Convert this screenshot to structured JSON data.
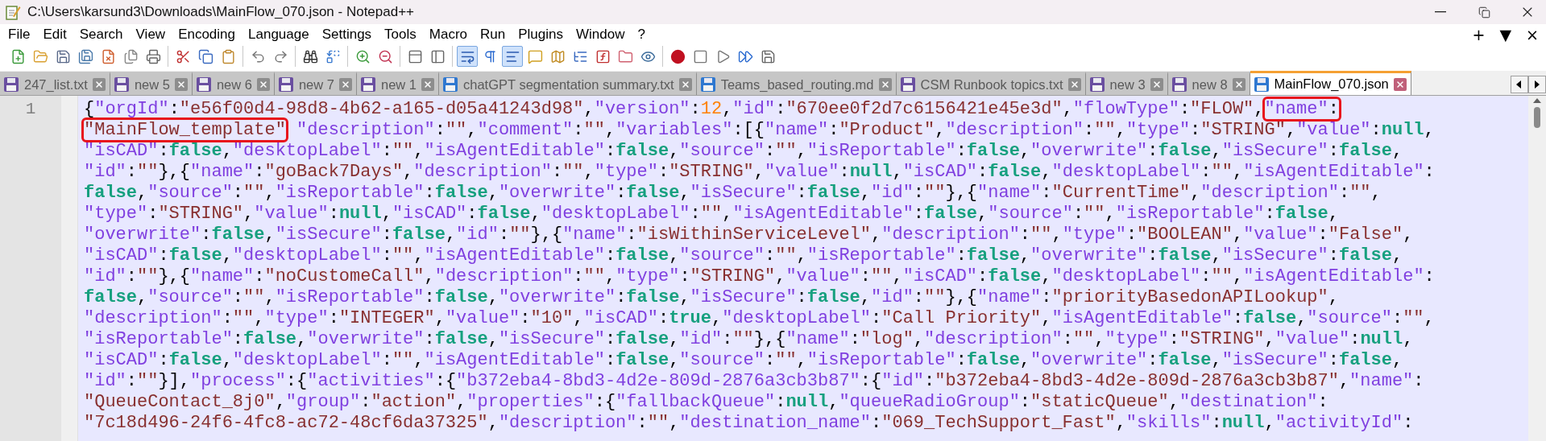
{
  "window": {
    "title": "C:\\Users\\karsund3\\Downloads\\MainFlow_070.json - Notepad++"
  },
  "menu": [
    "File",
    "Edit",
    "Search",
    "View",
    "Encoding",
    "Language",
    "Settings",
    "Tools",
    "Macro",
    "Run",
    "Plugins",
    "Window",
    "?"
  ],
  "menu_right": [
    "+",
    "▼",
    "×"
  ],
  "toolbar": [
    [
      {
        "pressed": false
      },
      {
        "pressed": false
      },
      {
        "pressed": false
      },
      {
        "pressed": false
      },
      {
        "pressed": false
      },
      {
        "pressed": false
      },
      {
        "pressed": false
      }
    ],
    [
      {
        "pressed": false
      },
      {
        "pressed": false
      },
      {
        "pressed": false
      }
    ],
    [
      {
        "pressed": false
      },
      {
        "pressed": false
      }
    ],
    [
      {
        "pressed": false
      },
      {
        "pressed": false
      }
    ],
    [
      {
        "pressed": false
      },
      {
        "pressed": false
      }
    ],
    [
      {
        "pressed": false
      },
      {
        "pressed": false
      }
    ],
    [
      {
        "pressed": true
      },
      {
        "pressed": false
      },
      {
        "pressed": true
      },
      {
        "pressed": false
      },
      {
        "pressed": false
      },
      {
        "pressed": false
      },
      {
        "pressed": false
      },
      {
        "pressed": false
      },
      {
        "pressed": false
      }
    ],
    [
      {
        "pressed": false
      },
      {
        "pressed": false
      },
      {
        "pressed": false
      },
      {
        "pressed": false
      },
      {
        "pressed": false
      }
    ]
  ],
  "tabs": [
    {
      "label": "247_list.txt",
      "color": "#6a4fa0",
      "selected": false
    },
    {
      "label": "new 5",
      "color": "#6a4fa0",
      "selected": false
    },
    {
      "label": "new 6",
      "color": "#6a4fa0",
      "selected": false
    },
    {
      "label": "new 7",
      "color": "#6a4fa0",
      "selected": false
    },
    {
      "label": "new 1",
      "color": "#6a4fa0",
      "selected": false
    },
    {
      "label": "chatGPT segmentation summary.txt",
      "color": "#2f78d0",
      "selected": false
    },
    {
      "label": "Teams_based_routing.md",
      "color": "#2f78d0",
      "selected": false
    },
    {
      "label": "CSM Runbook topics.txt",
      "color": "#6a4fa0",
      "selected": false
    },
    {
      "label": "new 3",
      "color": "#6a4fa0",
      "selected": false
    },
    {
      "label": "new 8",
      "color": "#6a4fa0",
      "selected": false
    },
    {
      "label": "MainFlow_070.json",
      "color": "#2f78d0",
      "selected": true
    }
  ],
  "editor": {
    "line_number": "1",
    "lines": [
      {
        "segments": [
          {
            "text": "{\"orgId\":\"e56f00d4-98d8-4b62-a165-d05a41243d98\",\"version\":12,\"id\":\"670ee0f2d7c6156421e45e3d\",\"flowType\":\"FLOW\",",
            "boxed": false
          },
          {
            "text": "\"name\":",
            "boxed": true
          }
        ]
      },
      {
        "segments": [
          {
            "text": "\"MainFlow_template\"",
            "boxed": true
          },
          {
            "text": " \"description\":\"\",\"comment\":\"\",\"variables\":[{\"name\":\"Product\",\"description\":\"\",\"type\":\"STRING\",\"value\":null,",
            "boxed": false
          }
        ]
      },
      {
        "segments": [
          {
            "text": "\"isCAD\":false,\"desktopLabel\":\"\",\"isAgentEditable\":false,\"source\":\"\",\"isReportable\":false,\"overwrite\":false,\"isSecure\":false,",
            "boxed": false
          }
        ]
      },
      {
        "segments": [
          {
            "text": "\"id\":\"\"},{\"name\":\"goBack7Days\",\"description\":\"\",\"type\":\"STRING\",\"value\":null,\"isCAD\":false,\"desktopLabel\":\"\",\"isAgentEditable\":",
            "boxed": false
          }
        ]
      },
      {
        "segments": [
          {
            "text": "false,\"source\":\"\",\"isReportable\":false,\"overwrite\":false,\"isSecure\":false,\"id\":\"\"},{\"name\":\"CurrentTime\",\"description\":\"\",",
            "boxed": false
          }
        ]
      },
      {
        "segments": [
          {
            "text": "\"type\":\"STRING\",\"value\":null,\"isCAD\":false,\"desktopLabel\":\"\",\"isAgentEditable\":false,\"source\":\"\",\"isReportable\":false,",
            "boxed": false
          }
        ]
      },
      {
        "segments": [
          {
            "text": "\"overwrite\":false,\"isSecure\":false,\"id\":\"\"},{\"name\":\"isWithinServiceLevel\",\"description\":\"\",\"type\":\"BOOLEAN\",\"value\":\"False\",",
            "boxed": false
          }
        ]
      },
      {
        "segments": [
          {
            "text": "\"isCAD\":false,\"desktopLabel\":\"\",\"isAgentEditable\":false,\"source\":\"\",\"isReportable\":false,\"overwrite\":false,\"isSecure\":false,",
            "boxed": false
          }
        ]
      },
      {
        "segments": [
          {
            "text": "\"id\":\"\"},{\"name\":\"noCustomeCall\",\"description\":\"\",\"type\":\"STRING\",\"value\":\"\",\"isCAD\":false,\"desktopLabel\":\"\",\"isAgentEditable\":",
            "boxed": false
          }
        ]
      },
      {
        "segments": [
          {
            "text": "false,\"source\":\"\",\"isReportable\":false,\"overwrite\":false,\"isSecure\":false,\"id\":\"\"},{\"name\":\"priorityBasedonAPILookup\",",
            "boxed": false
          }
        ]
      },
      {
        "segments": [
          {
            "text": "\"description\":\"\",\"type\":\"INTEGER\",\"value\":\"10\",\"isCAD\":true,\"desktopLabel\":\"Call Priority\",\"isAgentEditable\":false,\"source\":\"\",",
            "boxed": false
          }
        ]
      },
      {
        "segments": [
          {
            "text": "\"isReportable\":false,\"overwrite\":false,\"isSecure\":false,\"id\":\"\"},{\"name\":\"log\",\"description\":\"\",\"type\":\"STRING\",\"value\":null,",
            "boxed": false
          }
        ]
      },
      {
        "segments": [
          {
            "text": "\"isCAD\":false,\"desktopLabel\":\"\",\"isAgentEditable\":false,\"source\":\"\",\"isReportable\":false,\"overwrite\":false,\"isSecure\":false,",
            "boxed": false
          }
        ]
      },
      {
        "segments": [
          {
            "text": "\"id\":\"\"}],\"process\":{\"activities\":{\"b372eba4-8bd3-4d2e-809d-2876a3cb3b87\":{\"id\":\"b372eba4-8bd3-4d2e-809d-2876a3cb3b87\",\"name\":",
            "boxed": false
          }
        ]
      },
      {
        "segments": [
          {
            "text": "\"QueueContact_8j0\",\"group\":\"action\",\"properties\":{\"fallbackQueue\":null,\"queueRadioGroup\":\"staticQueue\",\"destination\":",
            "boxed": false
          }
        ]
      },
      {
        "segments": [
          {
            "text": "\"7c18d496-24f6-4fc8-ac72-48cf6da37325\",\"description\":\"\",\"destination_name\":\"069_TechSupport_Fast\",\"skills\":null,\"activityId\":",
            "boxed": false
          }
        ]
      }
    ]
  }
}
